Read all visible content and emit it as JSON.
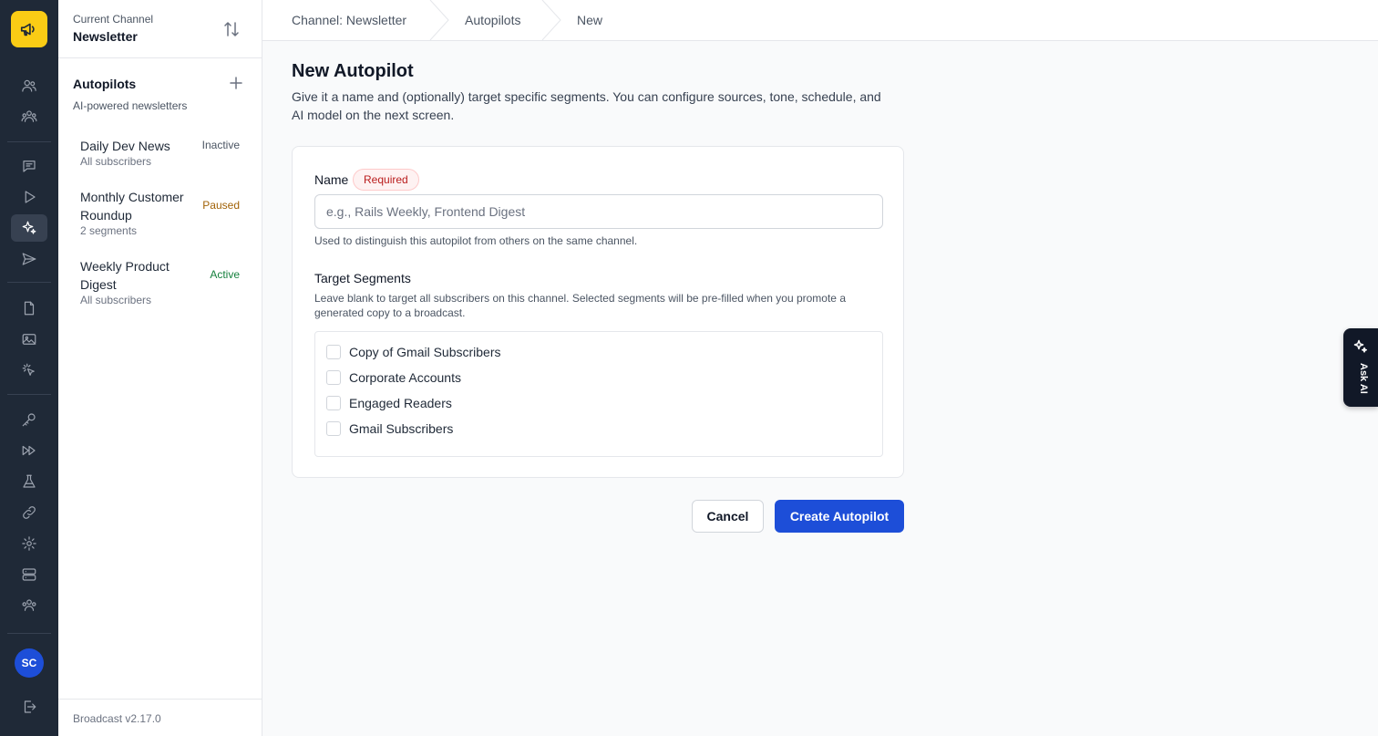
{
  "sidebar": {
    "channel_label": "Current Channel",
    "channel_name": "Newsletter",
    "section_title": "Autopilots",
    "section_subtitle": "AI-powered newsletters",
    "autopilots": [
      {
        "name": "Daily Dev News",
        "subtitle": "All subscribers",
        "status": "Inactive"
      },
      {
        "name": "Monthly Customer Roundup",
        "subtitle": "2 segments",
        "status": "Paused"
      },
      {
        "name": "Weekly Product Digest",
        "subtitle": "All subscribers",
        "status": "Active"
      }
    ],
    "version": "Broadcast v2.17.0"
  },
  "rail": {
    "active_item": "sparkles-icon",
    "avatar_initials": "SC"
  },
  "breadcrumb": [
    "Channel: Newsletter",
    "Autopilots",
    "New"
  ],
  "page": {
    "title": "New Autopilot",
    "description": "Give it a name and (optionally) target specific segments. You can configure sources, tone, schedule, and AI model on the next screen."
  },
  "form": {
    "name_label": "Name",
    "required_badge": "Required",
    "name_value": "",
    "name_placeholder": "e.g., Rails Weekly, Frontend Digest",
    "name_help": "Used to distinguish this autopilot from others on the same channel.",
    "segments_label": "Target Segments",
    "segments_help": "Leave blank to target all subscribers on this channel. Selected segments will be pre-filled when you promote a generated copy to a broadcast.",
    "segments": [
      {
        "label": "Copy of Gmail Subscribers",
        "checked": false
      },
      {
        "label": "Corporate Accounts",
        "checked": false
      },
      {
        "label": "Engaged Readers",
        "checked": false
      },
      {
        "label": "Gmail Subscribers",
        "checked": false
      }
    ]
  },
  "actions": {
    "cancel_label": "Cancel",
    "create_label": "Create Autopilot"
  },
  "ask_ai": {
    "label": "Ask AI"
  },
  "colors": {
    "brand_yellow": "#facc15",
    "rail_bg": "#1f2937",
    "primary_blue": "#1d4ed8",
    "required_red": "#b91c1c",
    "status_paused": "#a16207",
    "status_active": "#15803d"
  }
}
